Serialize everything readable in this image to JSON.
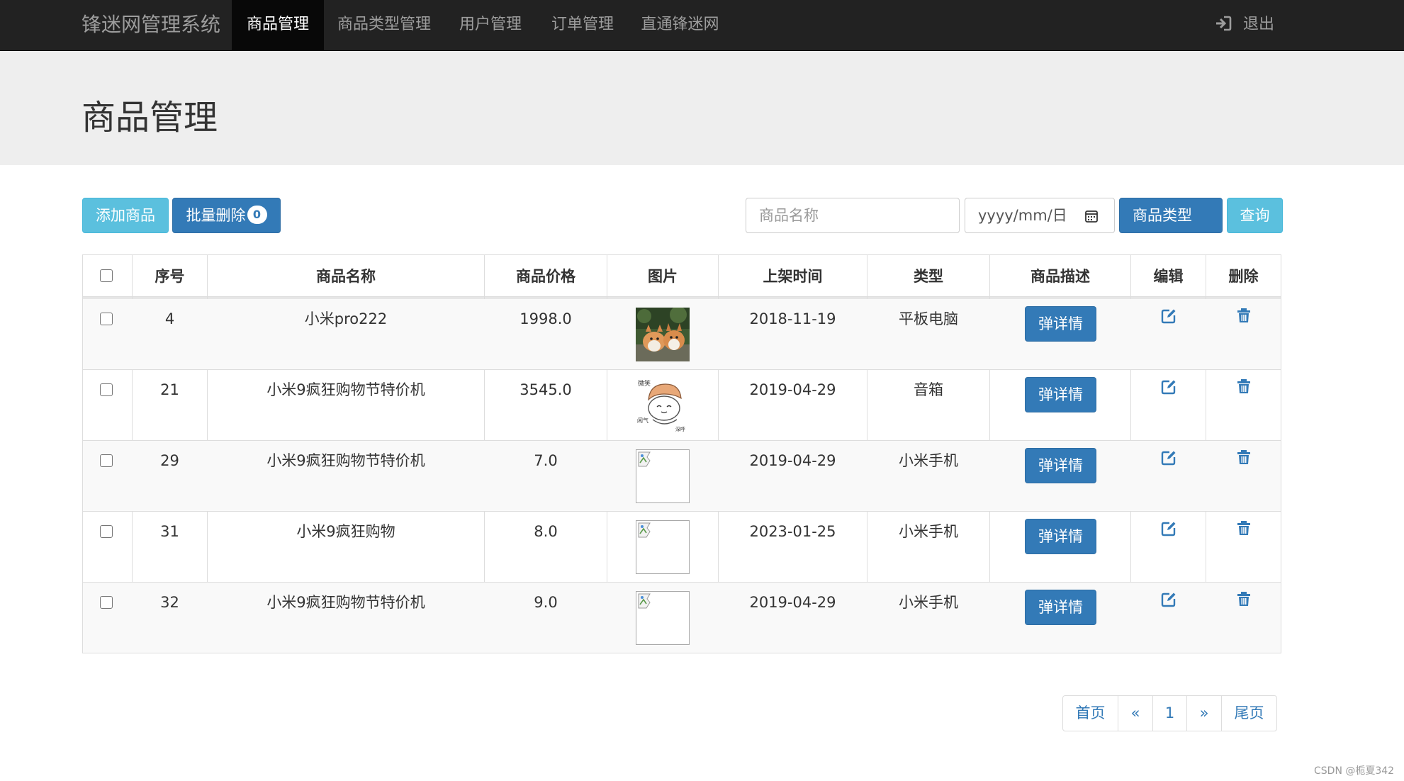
{
  "navbar": {
    "brand": "锋迷网管理系统",
    "items": [
      {
        "label": "商品管理",
        "active": true
      },
      {
        "label": "商品类型管理",
        "active": false
      },
      {
        "label": "用户管理",
        "active": false
      },
      {
        "label": "订单管理",
        "active": false
      },
      {
        "label": "直通锋迷网",
        "active": false
      }
    ],
    "logout_label": "退出",
    "logout_icon": "sign-in-icon"
  },
  "jumbotron": {
    "title": "商品管理"
  },
  "toolbar": {
    "add_label": "添加商品",
    "batch_delete_label": "批量删除",
    "batch_delete_count": "0",
    "name_placeholder": "商品名称",
    "date_placeholder": "yyyy/mm/日",
    "type_select_label": "商品类型",
    "query_label": "查询"
  },
  "table": {
    "headers": [
      "序号",
      "商品名称",
      "商品价格",
      "图片",
      "上架时间",
      "类型",
      "商品描述",
      "编辑",
      "删除"
    ],
    "rows": [
      {
        "id": "4",
        "name": "小米pro222",
        "price": "1998.0",
        "image": "corgi-photo",
        "date": "2018-11-19",
        "type": "平板电脑",
        "detail_label": "弹详情"
      },
      {
        "id": "21",
        "name": "小米9疯狂购物节特价机",
        "price": "3545.0",
        "image": "cartoon-meme",
        "date": "2019-04-29",
        "type": "音箱",
        "detail_label": "弹详情"
      },
      {
        "id": "29",
        "name": "小米9疯狂购物节特价机",
        "price": "7.0",
        "image": "broken-image",
        "date": "2019-04-29",
        "type": "小米手机",
        "detail_label": "弹详情"
      },
      {
        "id": "31",
        "name": "小米9疯狂购物",
        "price": "8.0",
        "image": "broken-image",
        "date": "2023-01-25",
        "type": "小米手机",
        "detail_label": "弹详情"
      },
      {
        "id": "32",
        "name": "小米9疯狂购物节特价机",
        "price": "9.0",
        "image": "broken-image",
        "date": "2019-04-29",
        "type": "小米手机",
        "detail_label": "弹详情"
      }
    ]
  },
  "pagination": {
    "first": "首页",
    "prev": "«",
    "current": "1",
    "next": "»",
    "last": "尾页"
  },
  "watermark": "CSDN @栀夏342",
  "colors": {
    "primary": "#337ab7",
    "info": "#5bc0de",
    "navbar": "#222222",
    "jumbotron": "#eeeeee"
  }
}
